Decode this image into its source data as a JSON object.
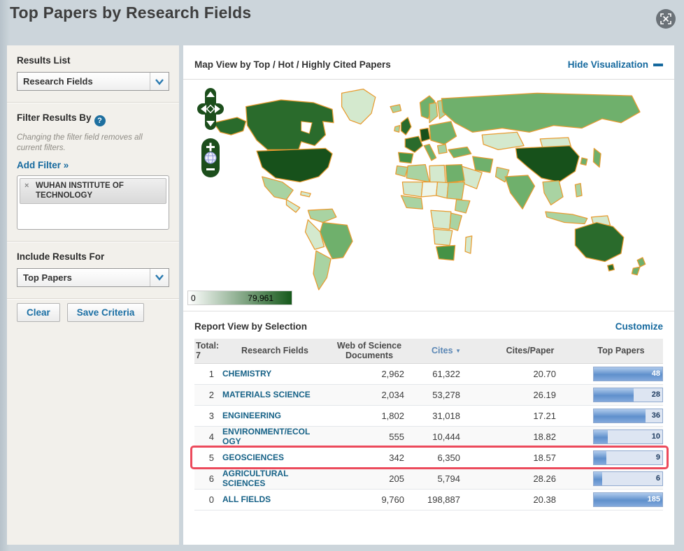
{
  "page": {
    "title": "Top Papers by Research Fields"
  },
  "sidebar": {
    "results_list": {
      "label": "Results List",
      "selected": "Research Fields"
    },
    "filter": {
      "heading": "Filter Results By",
      "help": "?",
      "note": "Changing the filter field removes all current filters.",
      "add_filter_label": "Add Filter »",
      "chip": {
        "remove": "×",
        "label": "WUHAN INSTITUTE OF TECHNOLOGY"
      }
    },
    "include_results": {
      "label": "Include Results For",
      "selected": "Top Papers"
    },
    "buttons": {
      "clear": "Clear",
      "save": "Save Criteria"
    }
  },
  "map_section": {
    "title": "Map View by Top / Hot / Highly Cited Papers",
    "hide_link": "Hide Visualization",
    "legend": {
      "min": "0",
      "max": "79,961"
    },
    "controls": {
      "zoom_in": "+",
      "zoom_out": "−"
    }
  },
  "report": {
    "title": "Report View by Selection",
    "customize_link": "Customize",
    "table": {
      "total_label": "Total:",
      "total_value": "7",
      "col_field": "Research Fields",
      "col_wos": "Web of Science Documents",
      "col_cites": "Cites",
      "col_cpp": "Cites/Paper",
      "col_top": "Top Papers",
      "sorted_column": "Cites",
      "bar_max": 48,
      "rows": [
        {
          "rank": "1",
          "field": "CHEMISTRY",
          "wos_docs": "2,962",
          "cites": "61,322",
          "cites_per_paper": "20.70",
          "top_papers": 48,
          "highlighted": false
        },
        {
          "rank": "2",
          "field": "MATERIALS SCIENCE",
          "wos_docs": "2,034",
          "cites": "53,278",
          "cites_per_paper": "26.19",
          "top_papers": 28,
          "highlighted": false
        },
        {
          "rank": "3",
          "field": "ENGINEERING",
          "wos_docs": "1,802",
          "cites": "31,018",
          "cites_per_paper": "17.21",
          "top_papers": 36,
          "highlighted": false
        },
        {
          "rank": "4",
          "field": "ENVIRONMENT/ECOLOGY",
          "wos_docs": "555",
          "cites": "10,444",
          "cites_per_paper": "18.82",
          "top_papers": 10,
          "highlighted": false
        },
        {
          "rank": "5",
          "field": "GEOSCIENCES",
          "wos_docs": "342",
          "cites": "6,350",
          "cites_per_paper": "18.57",
          "top_papers": 9,
          "highlighted": true
        },
        {
          "rank": "6",
          "field": "AGRICULTURAL SCIENCES",
          "wos_docs": "205",
          "cites": "5,794",
          "cites_per_paper": "28.26",
          "top_papers": 6,
          "highlighted": false
        },
        {
          "rank": "0",
          "field": "ALL FIELDS",
          "wos_docs": "9,760",
          "cites": "198,887",
          "cites_per_paper": "20.38",
          "top_papers": 185,
          "highlighted": false
        }
      ]
    }
  },
  "colors": {
    "link_blue": "#15699e",
    "highlight_red": "#ec4a5c",
    "map_border_orange": "#e89b30",
    "map_green_max": "#17511b",
    "bar_blue": "#5f90cc"
  }
}
